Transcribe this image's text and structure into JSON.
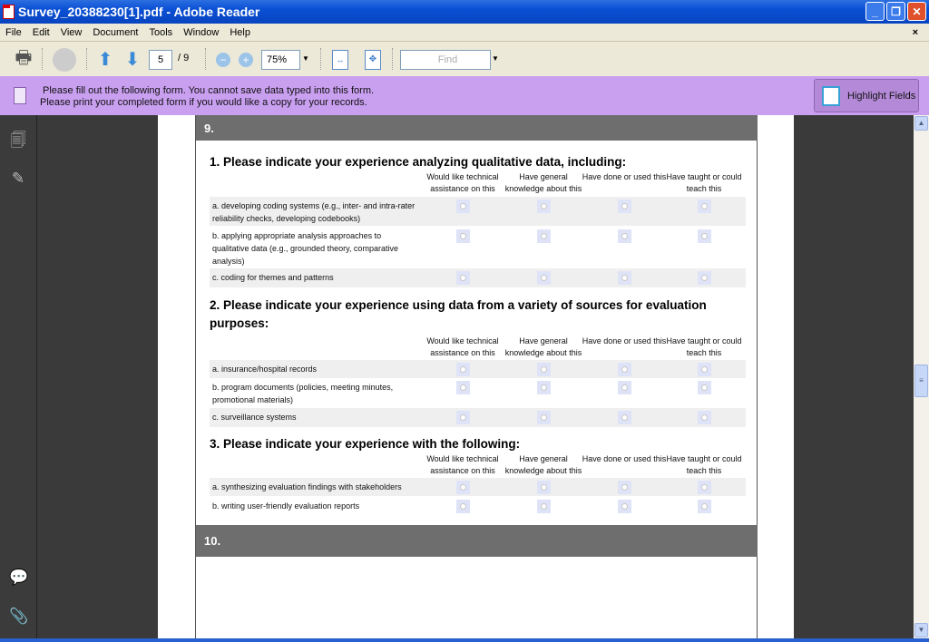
{
  "window": {
    "title": "Survey_20388230[1].pdf - Adobe Reader"
  },
  "menu": [
    "File",
    "Edit",
    "View",
    "Document",
    "Tools",
    "Window",
    "Help"
  ],
  "toolbar": {
    "page": "5",
    "page_total": "/ 9",
    "zoom": "75%",
    "find_placeholder": "Find"
  },
  "notice": {
    "line1": "Please fill out the following form. You cannot save data typed into this form.",
    "line2": "Please print your completed form if you would like a copy for your records.",
    "highlight_label": "Highlight Fields"
  },
  "sections": {
    "s9": "9.",
    "s10": "10."
  },
  "columns": [
    "Would like technical assistance on this",
    "Have general knowledge about this",
    "Have done or used this",
    "Have taught or could teach this"
  ],
  "questions": [
    {
      "title": "1. Please indicate your experience analyzing qualitative data, including:",
      "rows": [
        "a. developing coding systems (e.g., inter- and intra-rater reliability checks, developing codebooks)",
        "b. applying appropriate analysis approaches to qualitative data (e.g., grounded theory, comparative analysis)",
        "c. coding for themes and patterns"
      ]
    },
    {
      "title": "2. Please indicate your experience using data from a variety of sources for evaluation purposes:",
      "rows": [
        "a. insurance/hospital records",
        "b. program documents (policies, meeting minutes, promotional materials)",
        "c. surveillance systems"
      ]
    },
    {
      "title": "3. Please indicate your experience with the following:",
      "rows": [
        "a. synthesizing evaluation findings with stakeholders",
        "b. writing user-friendly evaluation reports"
      ]
    }
  ]
}
